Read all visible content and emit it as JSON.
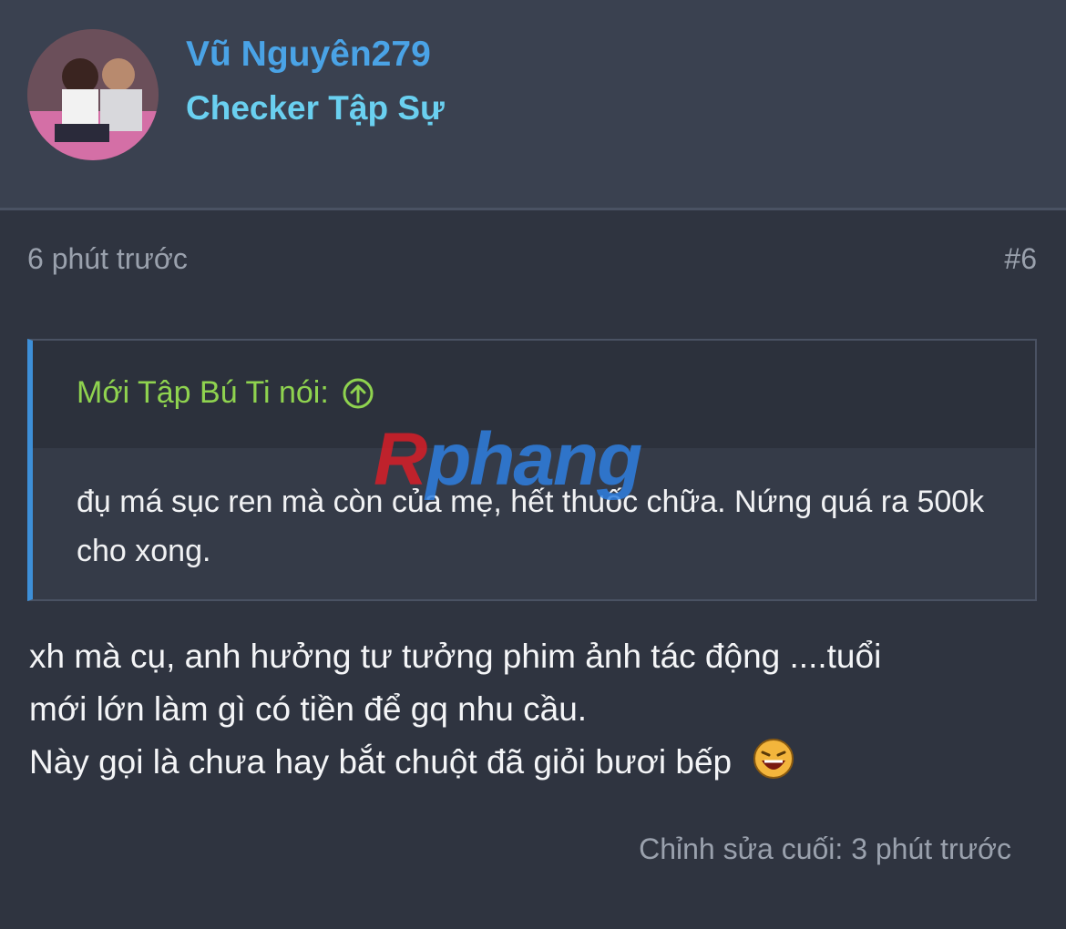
{
  "post": {
    "author": {
      "name": "Vũ Nguyên279",
      "title": "Checker Tập Sự"
    },
    "time": "6 phút trước",
    "number": "#6",
    "quote": {
      "author": "Mới Tập Bú Ti nói:",
      "text": "đụ má sục ren mà còn của mẹ, hết thuốc chữa. Nứng quá ra 500k cho xong."
    },
    "body": {
      "line1": "xh mà cụ, anh hưởng tư tưởng phim ảnh tác động ....tuổi",
      "line2": "mới lớn làm gì có tiền để gq nhu cầu.",
      "line3": "Này gọi là chưa hay bắt chuột đã giỏi bươi bếp"
    },
    "edited": "Chỉnh sửa cuối: 3 phút trước"
  },
  "watermark": {
    "first": "R",
    "rest": "phang"
  },
  "colors": {
    "username": "#4aa3e6",
    "user_title": "#6ad0f0",
    "quote_author": "#8fd34f",
    "quote_border": "#3d8fd8"
  },
  "icons": {
    "quote_jump": "circle-up-arrow-icon",
    "emoji": "laughing-emoji-icon"
  }
}
